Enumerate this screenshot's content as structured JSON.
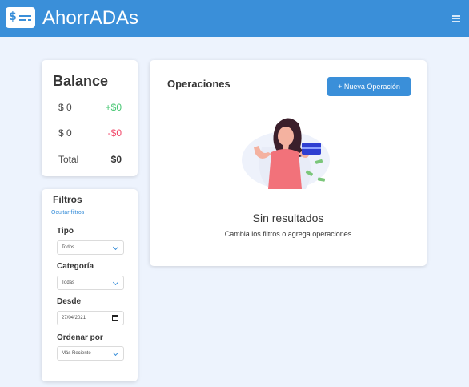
{
  "navbar": {
    "brand": "AhorrADAs",
    "logo_glyph": "$"
  },
  "balance": {
    "title": "Balance",
    "rows": [
      {
        "label": "$ 0",
        "value": "+$0",
        "status": "income"
      },
      {
        "label": "$ 0",
        "value": "-$0",
        "status": "expense"
      },
      {
        "label": "Total",
        "value": "$0",
        "status": "total"
      }
    ]
  },
  "filters": {
    "title": "Filtros",
    "hide_link": "Ocultar filtros",
    "type": {
      "label": "Tipo",
      "value": "Todos"
    },
    "category": {
      "label": "Categoría",
      "value": "Todas"
    },
    "since": {
      "label": "Desde",
      "value": "27/04/2021"
    },
    "order": {
      "label": "Ordenar por",
      "value": "Más Reciente"
    }
  },
  "operations": {
    "title": "Operaciones",
    "new_button": "+ Nueva Operación",
    "empty_title": "Sin resultados",
    "empty_subtitle": "Cambia los filtros o agrega operaciones"
  },
  "colors": {
    "primary": "#3a8fd9",
    "income": "#48c774",
    "expense": "#f14668",
    "background": "#edf3fd"
  },
  "icons": {
    "menu": "hamburger-icon",
    "chevron": "chevron-down-icon",
    "calendar": "calendar-icon"
  }
}
